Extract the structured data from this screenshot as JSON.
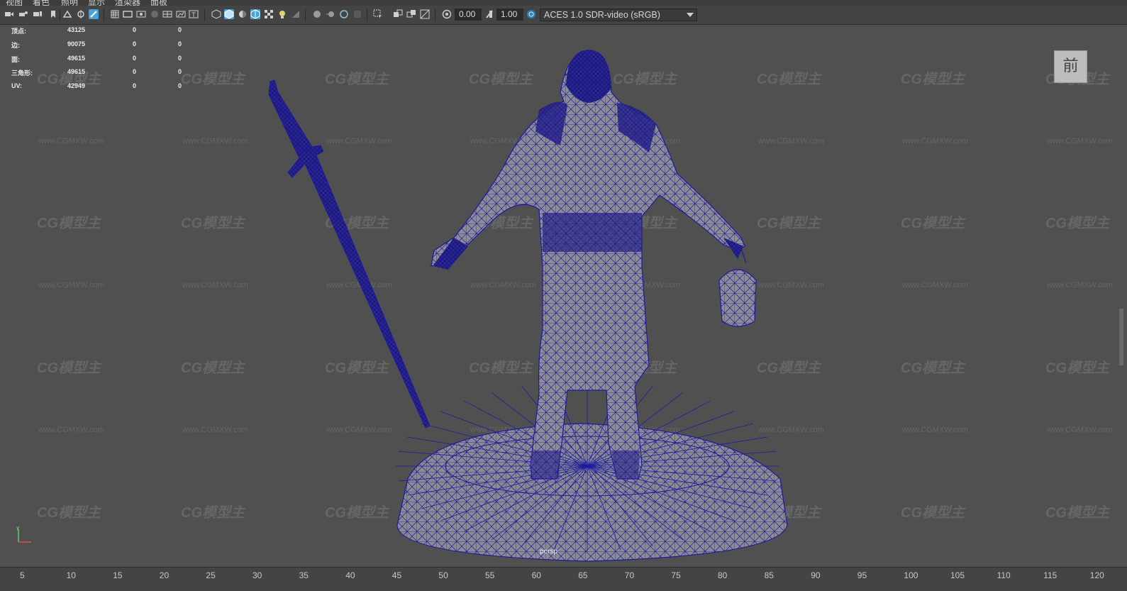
{
  "menu": [
    "视图",
    "着色",
    "照明",
    "显示",
    "渲染器",
    "面板"
  ],
  "toolbar": {
    "value1": "0.00",
    "value2": "1.00",
    "colorspace": "ACES 1.0 SDR-video (sRGB)"
  },
  "hud": {
    "rows": [
      {
        "label": "顶点:",
        "a": "43125",
        "b": "0",
        "c": "0"
      },
      {
        "label": "边:",
        "a": "90075",
        "b": "0",
        "c": "0"
      },
      {
        "label": "面:",
        "a": "49615",
        "b": "0",
        "c": "0"
      },
      {
        "label": "三角形:",
        "a": "49615",
        "b": "0",
        "c": "0"
      },
      {
        "label": "UV:",
        "a": "42949",
        "b": "0",
        "c": "0"
      }
    ]
  },
  "viewcube_label": "前",
  "camera_label": "persp",
  "watermark": {
    "logo": "CG模型主",
    "url": "www.CGMXW.com"
  },
  "timeline_ticks": [
    "5",
    "10",
    "15",
    "20",
    "25",
    "30",
    "35",
    "40",
    "45",
    "50",
    "55",
    "60",
    "65",
    "70",
    "75",
    "80",
    "85",
    "90",
    "95",
    "100",
    "105",
    "110",
    "115",
    "120"
  ],
  "colors": {
    "wire": "#1d1a9e",
    "viewport": "#505050",
    "toolbar": "#444444",
    "accent": "#4aa3d6"
  }
}
